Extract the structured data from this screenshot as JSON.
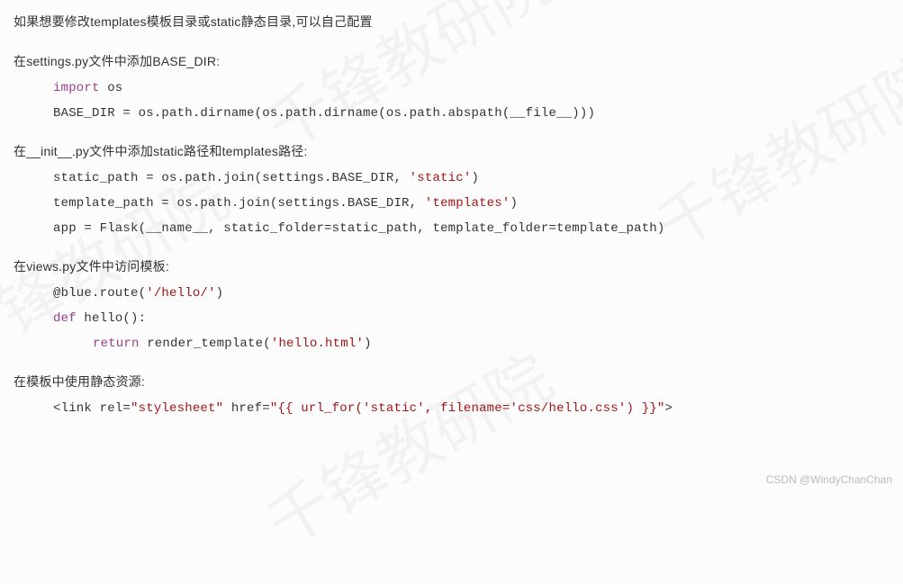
{
  "lines": {
    "l1": "如果想要修改templates模板目录或static静态目录,可以自己配置",
    "l2": "在settings.py文件中添加BASE_DIR:",
    "l3_kw": "import",
    "l3_rest": " os",
    "l4": "BASE_DIR = os.path.dirname(os.path.dirname(os.path.abspath(__file__)))",
    "l5": "在__init__.py文件中添加static路径和templates路径:",
    "l6a": "static_path = os.path.join(settings.BASE_DIR, ",
    "l6b": "'static'",
    "l6c": ")",
    "l7a": "template_path = os.path.join(settings.BASE_DIR, ",
    "l7b": "'templates'",
    "l7c": ")",
    "l8": "app = Flask(__name__, static_folder=static_path, template_folder=template_path)",
    "l9": "在views.py文件中访问模板:",
    "l10a": "@blue.route(",
    "l10b": "'/hello/'",
    "l10c": ")",
    "l11a": "def",
    "l11b": " hello():",
    "l12a": "return",
    "l12b": " render_template(",
    "l12c": "'hello.html'",
    "l12d": ")",
    "l13": "在模板中使用静态资源:",
    "l14a": "<link rel=",
    "l14b": "\"stylesheet\"",
    "l14c": " href=",
    "l14d": "\"{{ url_for('static', filename='css/hello.css') }}\"",
    "l14e": ">"
  },
  "footer": "CSDN @WindyChanChan",
  "watermark": "千锋教研院"
}
